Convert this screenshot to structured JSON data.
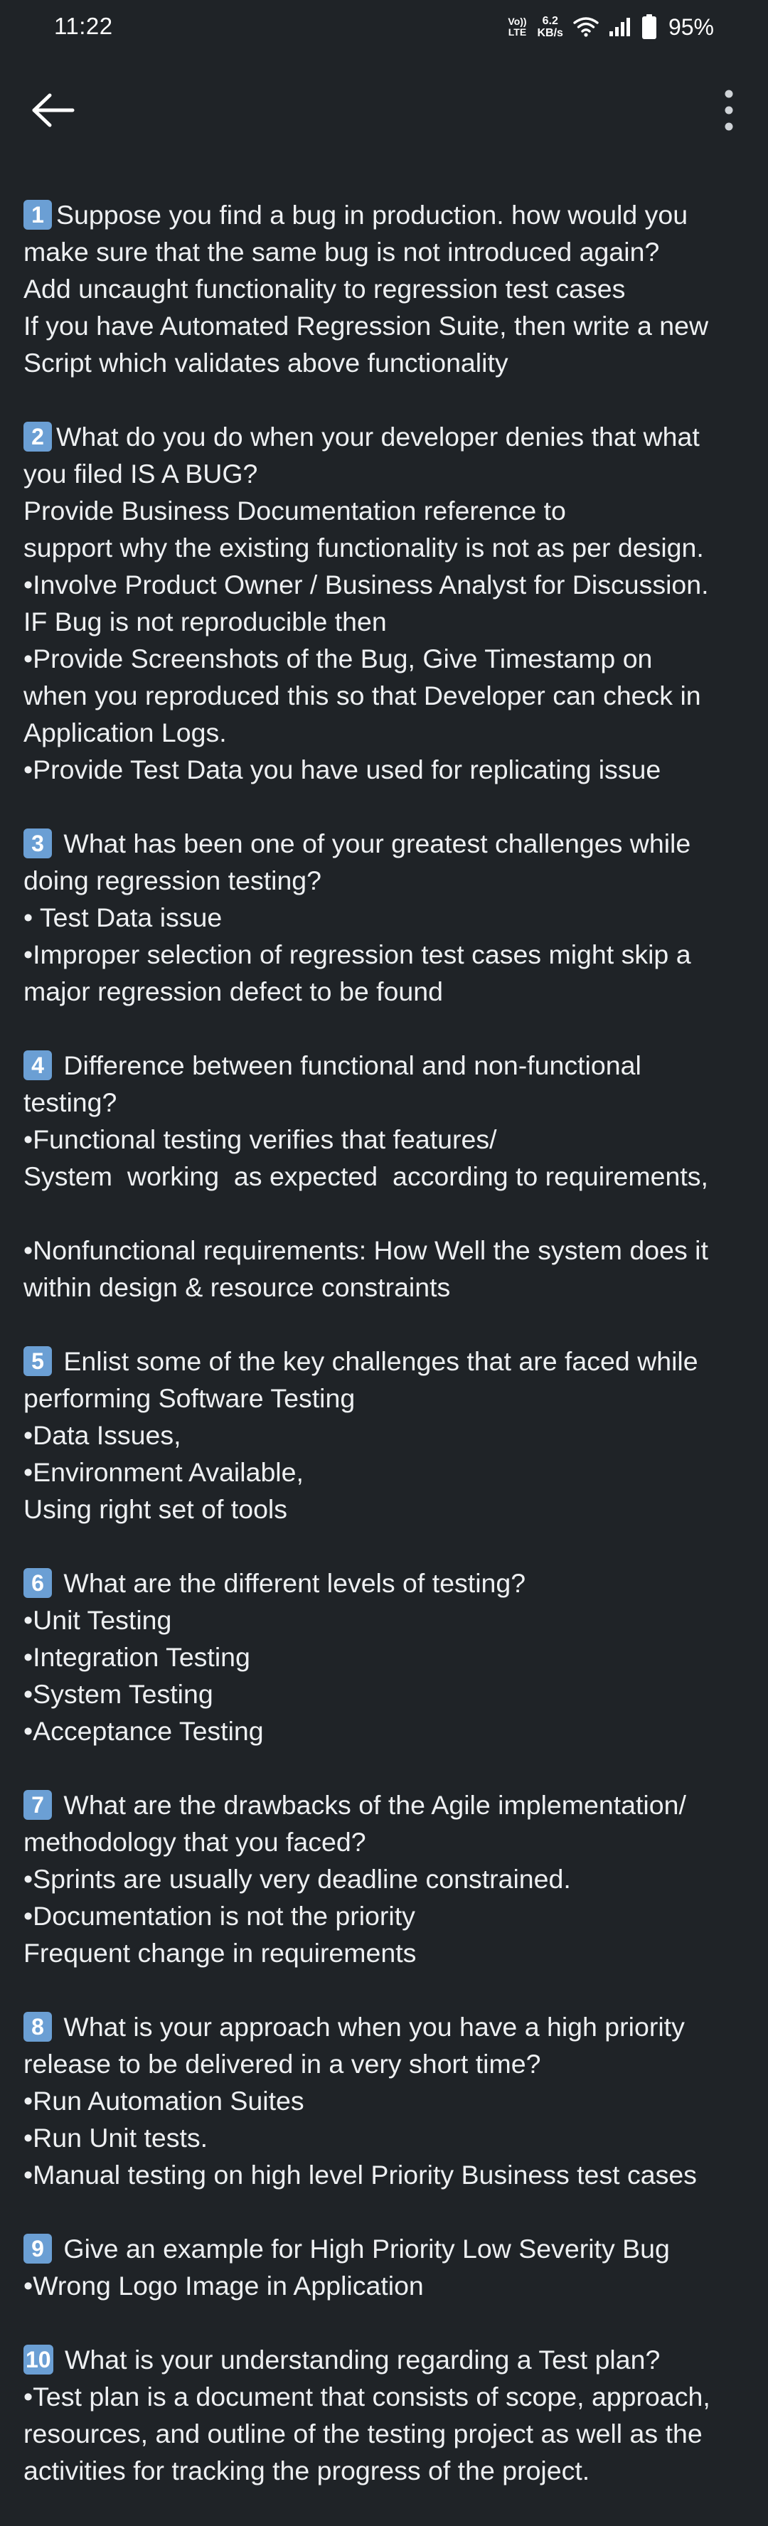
{
  "status_bar": {
    "time": "11:22",
    "volte_top": "Vo))",
    "volte_bottom": "LTE",
    "net_speed_value": "6.2",
    "net_speed_unit": "KB/s",
    "battery_percent": "95%"
  },
  "toolbar": {
    "back_icon": "arrow-left-icon",
    "more_icon": "more-vertical-icon"
  },
  "colors": {
    "background": "#1f2327",
    "text": "#eef0f2",
    "badge": "#6b9fd4"
  },
  "questions": [
    {
      "number": "1",
      "question_lines": [
        "Suppose you find a bug in production. how would you",
        "make sure that the same bug is not introduced again?"
      ],
      "answer_lines": [
        "Add uncaught functionality to regression test cases",
        "If you have Automated Regression Suite, then write a new",
        "Script which validates above functionality"
      ]
    },
    {
      "number": "2",
      "question_lines": [
        "What do you do when your developer denies that what",
        "you filed IS A BUG?"
      ],
      "answer_lines": [
        "Provide Business Documentation reference to",
        "support why the existing functionality is not as per design.",
        "•Involve Product Owner / Business Analyst for Discussion.",
        "IF Bug is not reproducible then",
        "•Provide Screenshots of the Bug, Give Timestamp on",
        "when you reproduced this so that Developer can check in",
        "Application Logs.",
        "•Provide Test Data you have used for replicating issue"
      ]
    },
    {
      "number": "3",
      "question_lines": [
        " What has been one of your greatest challenges while",
        "doing regression testing?"
      ],
      "answer_lines": [
        "• Test Data issue",
        "•Improper selection of regression test cases might skip a",
        "major regression defect to be found"
      ]
    },
    {
      "number": "4",
      "question_lines": [
        " Difference between functional and non-functional",
        "testing?"
      ],
      "answer_lines": [
        "•Functional testing verifies that features/",
        "System  working  as expected  according to requirements,",
        "",
        "•Nonfunctional requirements: How Well the system does it",
        "within design & resource constraints"
      ]
    },
    {
      "number": "5",
      "question_lines": [
        " Enlist some of the key challenges that are faced while",
        "performing Software Testing"
      ],
      "answer_lines": [
        "•Data Issues,",
        "•Environment Available,",
        "Using right set of tools"
      ]
    },
    {
      "number": "6",
      "question_lines": [
        " What are the different levels of testing?"
      ],
      "answer_lines": [
        "•Unit Testing",
        "•Integration Testing",
        "•System Testing",
        "•Acceptance Testing"
      ]
    },
    {
      "number": "7",
      "question_lines": [
        " What are the drawbacks of the Agile implementation/",
        "methodology that you faced?"
      ],
      "answer_lines": [
        "•Sprints are usually very deadline constrained.",
        "•Documentation is not the priority",
        "Frequent change in requirements"
      ]
    },
    {
      "number": "8",
      "question_lines": [
        " What is your approach when you have a high priority",
        "release to be delivered in a very short time?"
      ],
      "answer_lines": [
        "•Run Automation Suites",
        "•Run Unit tests.",
        "•Manual testing on high level Priority Business test cases"
      ]
    },
    {
      "number": "9",
      "question_lines": [
        " Give an example for High Priority Low Severity Bug"
      ],
      "answer_lines": [
        "•Wrong Logo Image in Application"
      ]
    },
    {
      "number": "10",
      "question_lines": [
        " What is your understanding regarding a Test plan?"
      ],
      "answer_lines": [
        "•Test plan is a document that consists of scope, approach,",
        "resources, and outline of the testing project as well as the",
        "activities for tracking the progress of the project."
      ]
    }
  ]
}
